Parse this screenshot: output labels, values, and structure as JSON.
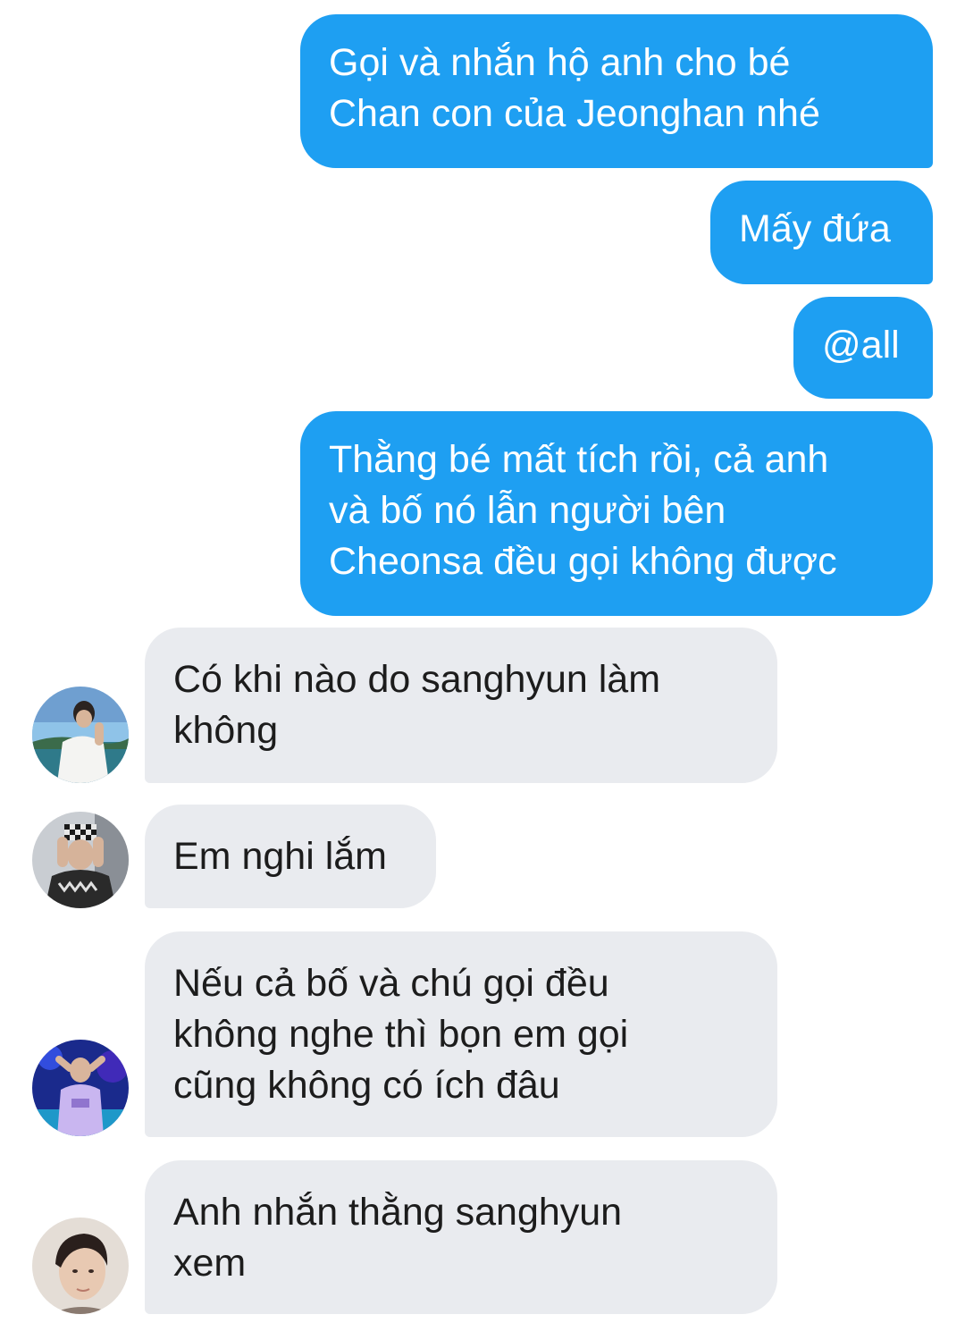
{
  "messages": {
    "outgoing": [
      {
        "text": "Gọi và nhắn hộ anh cho bé\nChan con của Jeonghan nhé"
      },
      {
        "text": "Mấy đứa"
      },
      {
        "text": "@all"
      },
      {
        "text": "Thằng bé mất tích rồi, cả anh\nvà bố nó lẫn người bên\nCheonsa đều gọi không được"
      }
    ],
    "incoming": [
      {
        "text": "Có khi nào do sanghyun làm\nkhông",
        "avatar": "avatar-photo-seaside"
      },
      {
        "text": "Em nghi lắm",
        "avatar": "avatar-photo-checkered-hat"
      },
      {
        "text": "Nếu cả bố và chú gọi đều\nkhông nghe thì bọn em gọi\ncũng không có ích đâu",
        "avatar": "avatar-photo-stage-blue"
      },
      {
        "text": "Anh nhắn thằng sanghyun\nxem",
        "avatar": "avatar-photo-portrait"
      }
    ]
  },
  "colors": {
    "outgoing_bubble": "#1e9ff2",
    "incoming_bubble": "#e9ebef",
    "outgoing_text": "#ffffff",
    "incoming_text": "#1c1c1c"
  }
}
